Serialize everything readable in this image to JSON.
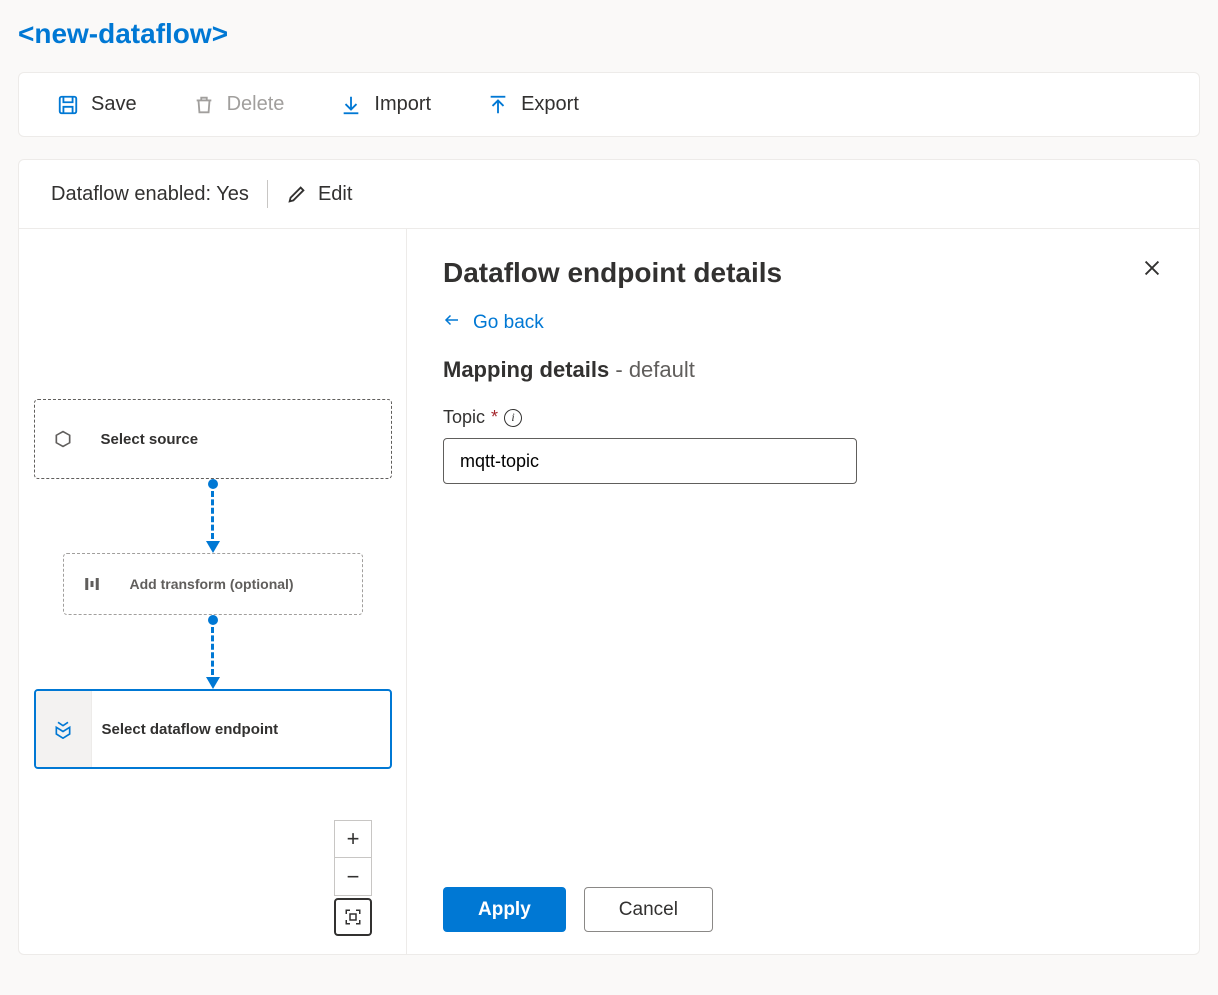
{
  "pageTitle": "<new-dataflow>",
  "commands": {
    "save": "Save",
    "delete": "Delete",
    "import": "Import",
    "export": "Export"
  },
  "status": {
    "label": "Dataflow enabled: Yes",
    "edit": "Edit"
  },
  "nodes": {
    "source": "Select source",
    "transform": "Add transform (optional)",
    "endpoint": "Select dataflow endpoint"
  },
  "details": {
    "title": "Dataflow endpoint details",
    "goBack": "Go back",
    "mappingLabel": "Mapping details",
    "mappingSeparator": " - ",
    "mappingValue": "default",
    "topicLabel": "Topic",
    "topicValue": "mqtt-topic",
    "applyLabel": "Apply",
    "cancelLabel": "Cancel"
  }
}
